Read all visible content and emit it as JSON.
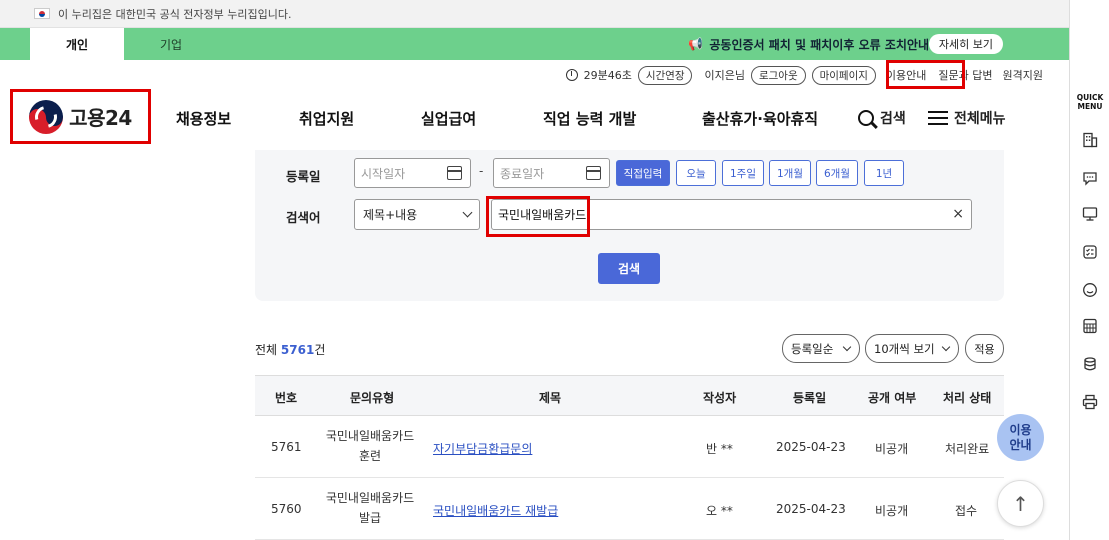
{
  "gov_banner": {
    "text": "이 누리집은 대한민국 공식 전자정부 누리집입니다."
  },
  "tabs": [
    {
      "label": "개인",
      "active": true
    },
    {
      "label": "기업",
      "active": false
    }
  ],
  "notice": {
    "text": "공동인증서 패치 및 패치이후 오류 조치안내",
    "button": "자세히 보기"
  },
  "utility": {
    "timer": "29분46초",
    "extend": "시간연장",
    "user": "이지은님",
    "logout": "로그아웃",
    "mypage": "마이페이지",
    "usage": "이용안내",
    "qna": "질문과 답변",
    "remote": "원격지원"
  },
  "logo": {
    "text": "고용24"
  },
  "gnb": [
    "채용정보",
    "취업지원",
    "실업급여",
    "직업 능력 개발",
    "출산휴가·육아휴직"
  ],
  "header_search": "검색",
  "header_menu": "전체메뉴",
  "filter": {
    "date_label": "등록일",
    "start_placeholder": "시작일자",
    "end_placeholder": "종료일자",
    "separator": "-",
    "periods": [
      "직접입력",
      "오늘",
      "1주일",
      "1개월",
      "6개월",
      "1년"
    ],
    "keyword_label": "검색어",
    "scope": "제목+내용",
    "keyword": "국민내일배움카드",
    "clear": "×",
    "search_button": "검색"
  },
  "summary": {
    "prefix": "전체 ",
    "count": "5761",
    "suffix": "건"
  },
  "sort": {
    "order": "등록일순",
    "page_size": "10개씩 보기",
    "apply": "적용"
  },
  "table": {
    "headers": [
      "번호",
      "문의유형",
      "제목",
      "작성자",
      "등록일",
      "공개 여부",
      "처리 상태"
    ],
    "rows": [
      {
        "no": "5761",
        "type": "국민내일배움카드 훈련",
        "title": "자기부담금환급문의",
        "writer": "반 **",
        "date": "2025-04-23",
        "public": "비공개",
        "status": "처리완료"
      },
      {
        "no": "5760",
        "type": "국민내일배움카드 발급",
        "title": "국민내일배움카드 재발급",
        "writer": "오 **",
        "date": "2025-04-23",
        "public": "비공개",
        "status": "접수"
      }
    ]
  },
  "floating": {
    "guide": "이용\n안내",
    "top": "↑"
  },
  "quick_menu": {
    "title_line1": "QUICK",
    "title_line2": "MENU"
  },
  "colors": {
    "green": "#6dd08c",
    "blue": "#4a68d8",
    "highlight": "#e00000"
  }
}
